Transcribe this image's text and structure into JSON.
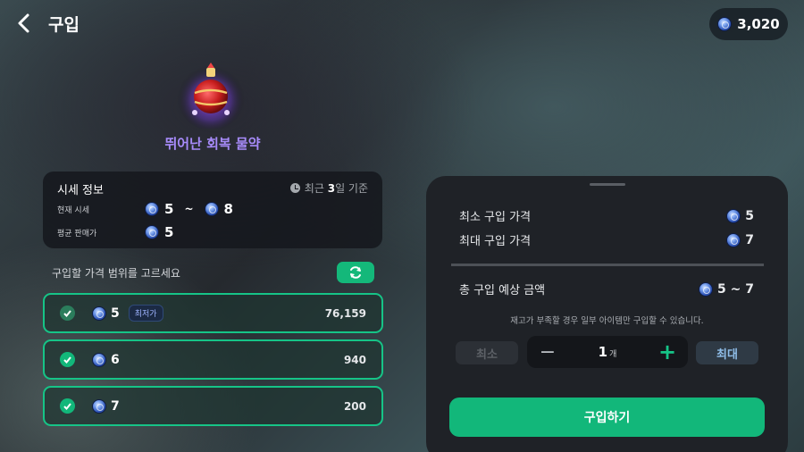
{
  "header": {
    "title": "구입",
    "balance": "3,020"
  },
  "item": {
    "name": "뛰어난 회복 물약",
    "image": "red-potion-icon"
  },
  "market": {
    "title": "시세 정보",
    "basis": {
      "prefix": "최근 ",
      "days": "3",
      "suffix": "일 기준"
    },
    "current_label": "현재 시세",
    "current_min": "5",
    "tilde": "~",
    "current_max": "8",
    "avg_label": "평균 판매가",
    "avg_value": "5"
  },
  "range_label": "구입할 가격 범위를 고르세요",
  "options": [
    {
      "price": "5",
      "badge": "최저가",
      "qty": "76,159",
      "checked": true
    },
    {
      "price": "6",
      "qty": "940",
      "checked": true
    },
    {
      "price": "7",
      "qty": "200",
      "checked": true
    }
  ],
  "panel": {
    "min_price_label": "최소 구입 가격",
    "min_price": "5",
    "max_price_label": "최대 구입 가격",
    "max_price": "7",
    "total_label": "총 구입 예상 금액",
    "total": "5 ~ 7",
    "notice": "재고가 부족할 경우 일부 아이템만 구입할 수 있습니다.",
    "min_btn": "최소",
    "count": "1",
    "unit": "개",
    "max_btn": "최대",
    "buy_btn": "구입하기"
  },
  "colors": {
    "accent": "#12b77a",
    "item_name": "#a78bfa",
    "panel": "#1f2227"
  }
}
